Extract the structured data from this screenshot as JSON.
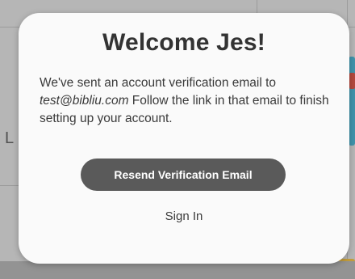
{
  "dialog": {
    "title": "Welcome Jes!",
    "message_prefix": "We've sent an account verification email to ",
    "email": "test@bibliu.com",
    "message_suffix": " Follow the link in that email to finish setting up your account.",
    "resend_button_label": "Resend Verification Email",
    "signin_label": "Sign In"
  },
  "background": {
    "left_letter": "L"
  },
  "colors": {
    "dialog_background": "#fafafa",
    "button_background": "#5a5a5a",
    "title_text": "#333333",
    "body_text": "#3a3a3a"
  }
}
